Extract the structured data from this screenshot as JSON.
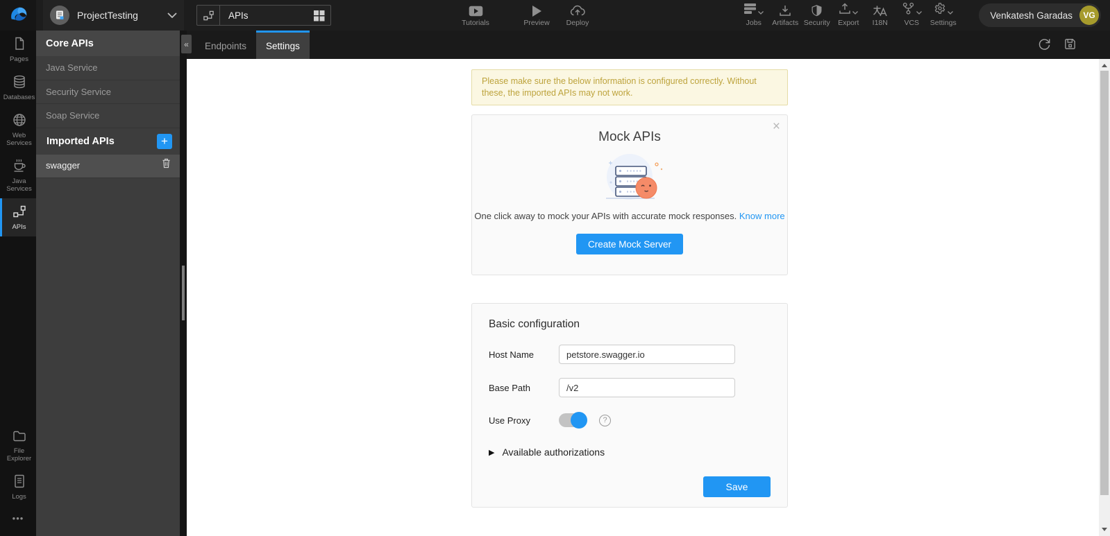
{
  "topbar": {
    "project_name": "ProjectTesting",
    "selector_value": "APIs",
    "center_actions": [
      {
        "label": "Tutorials"
      },
      {
        "label": "Preview"
      },
      {
        "label": "Deploy"
      }
    ],
    "right_actions": [
      {
        "label": "Jobs"
      },
      {
        "label": "Artifacts"
      },
      {
        "label": "Security"
      },
      {
        "label": "Export"
      },
      {
        "label": "I18N"
      },
      {
        "label": "VCS"
      },
      {
        "label": "Settings"
      }
    ],
    "user": {
      "name": "Venkatesh Garadas",
      "initials": "VG"
    }
  },
  "rail": {
    "top": [
      {
        "label": "Pages"
      },
      {
        "label": "Databases"
      },
      {
        "label": "Web Services"
      },
      {
        "label": "Java Services"
      },
      {
        "label": "APIs"
      }
    ],
    "bottom": [
      {
        "label": "File Explorer"
      },
      {
        "label": "Logs"
      }
    ],
    "more": "•••"
  },
  "panel": {
    "title": "Core APIs",
    "collapse": "«",
    "core_items": [
      {
        "label": "Java Service"
      },
      {
        "label": "Security Service"
      },
      {
        "label": "Soap Service"
      }
    ],
    "imported_title": "Imported APIs",
    "add": "+",
    "selected_item": "swagger"
  },
  "tabs": [
    {
      "label": "Endpoints"
    },
    {
      "label": "Settings"
    }
  ],
  "settings_page": {
    "warning": "Please make sure the below information is configured correctly. Without these, the imported APIs may not work.",
    "mock": {
      "close": "×",
      "title": "Mock APIs",
      "description": "One click away to mock your APIs with accurate mock responses.",
      "link": "Know more",
      "button": "Create Mock Server"
    },
    "config": {
      "title": "Basic configuration",
      "host_label": "Host Name",
      "host_value": "petstore.swagger.io",
      "base_label": "Base Path",
      "base_value": "/v2",
      "proxy_label": "Use Proxy",
      "proxy_on": true,
      "help": "?",
      "authorizations": "Available authorizations",
      "expand_arrow": "▶",
      "save": "Save"
    }
  },
  "colors": {
    "accent": "#2196f3",
    "warning_text": "#bda33c",
    "avatar_bg": "#a69b2c",
    "topbar_bg": "#1d1d1d",
    "panel_bg": "#3d3d3d"
  }
}
